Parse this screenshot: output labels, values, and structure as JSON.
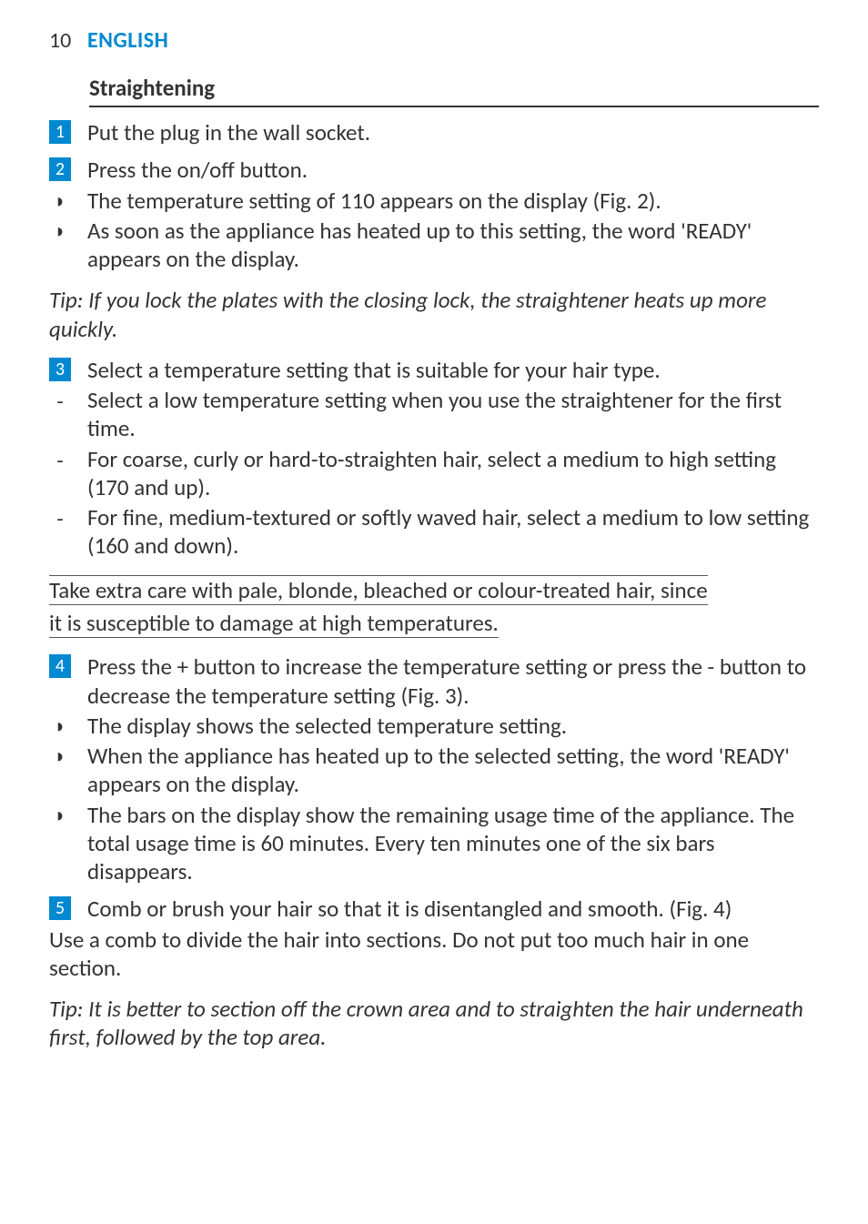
{
  "header": {
    "page_number": "10",
    "language": "ENGLISH"
  },
  "section_title": "Straightening",
  "steps": {
    "s1": {
      "num": "1",
      "text": "Put the plug in the wall socket."
    },
    "s2": {
      "num": "2",
      "text": "Press the on/off button.",
      "subs": [
        "The temperature setting of 110 appears on the display (Fig. 2).",
        "As soon as the appliance has heated up to this setting, the word 'READY' appears on the display."
      ]
    },
    "tip1": "Tip: If you lock the plates with the closing lock, the straightener heats up more quickly.",
    "s3": {
      "num": "3",
      "text": "Select a temperature setting that is suitable for your hair type.",
      "dashes": [
        "Select a low temperature setting when you use the straightener for the first time.",
        "For coarse, curly or hard-to-straighten hair, select a medium to high setting (170 and up).",
        "For fine, medium-textured or softly waved hair, select a medium to low setting (160 and down)."
      ]
    },
    "warning": {
      "line1": "Take extra care with pale, blonde, bleached or colour-treated hair, since ",
      "line2": "it is susceptible to damage at high temperatures."
    },
    "s4": {
      "num": "4",
      "text": "Press the + button to increase the temperature setting or press the - button to decrease the temperature setting (Fig. 3).",
      "subs": [
        "The display shows the selected temperature setting.",
        "When the appliance has heated up to the selected setting, the word 'READY' appears on the display.",
        "The bars on the display show the remaining usage time of the appliance. The total usage time is 60 minutes. Every ten minutes one of the six bars disappears."
      ]
    },
    "s5": {
      "num": "5",
      "text": "Comb or brush your hair so that it is disentangled and smooth.  (Fig. 4)"
    },
    "after5": "Use a comb to divide the hair into sections. Do not put too much hair in one section.",
    "tip2": "Tip: It is better to section off the crown area and to straighten the hair underneath first, followed by the top area."
  }
}
